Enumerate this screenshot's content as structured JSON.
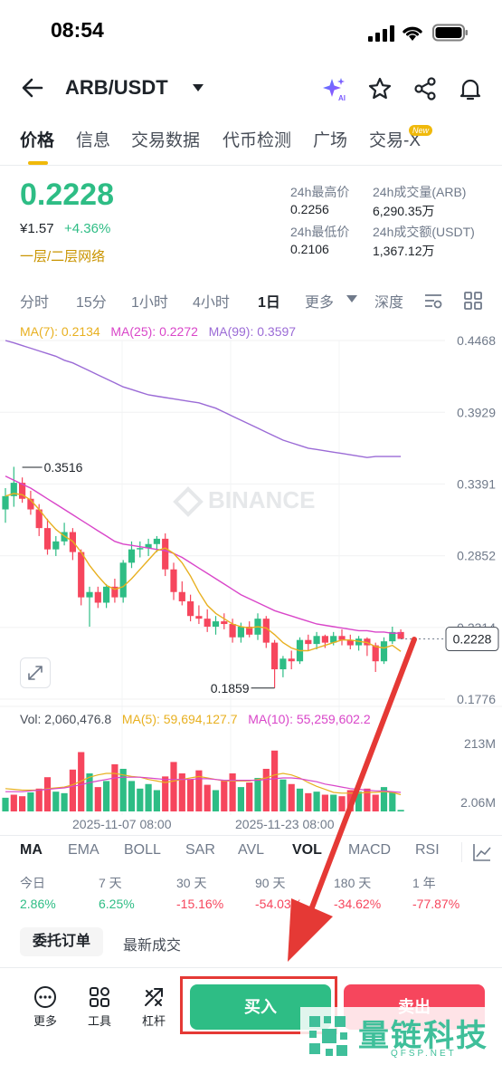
{
  "status_bar": {
    "time": "08:54"
  },
  "header": {
    "pair": "ARB/USDT"
  },
  "tabs": [
    "价格",
    "信息",
    "交易数据",
    "代币检测",
    "广场",
    "交易-X"
  ],
  "new_badge": "New",
  "ticker": {
    "price": "0.2228",
    "fiat": "¥1.57",
    "change": "+4.36%",
    "network": "一层/二层网络",
    "high_label": "24h最高价",
    "high_value": "0.2256",
    "low_label": "24h最低价",
    "low_value": "0.2106",
    "vol_label": "24h成交量(ARB)",
    "vol_value": "6,290.35万",
    "turnover_label": "24h成交额(USDT)",
    "turnover_value": "1,367.12万"
  },
  "intervals": [
    "分时",
    "15分",
    "1小时",
    "4小时",
    "1日",
    "更多",
    "深度"
  ],
  "ma": {
    "ma7": "MA(7): 0.2134",
    "ma25": "MA(25): 0.2272",
    "ma99": "MA(99): 0.3597"
  },
  "colors": {
    "up": "#2ebd85",
    "down": "#f6465d",
    "ma7": "#e8b020",
    "ma25": "#d946c9",
    "ma99": "#9b6bd6",
    "accent": "#f0b90b"
  },
  "chart_data": {
    "type": "candlestick",
    "y_ticks": [
      "0.4468",
      "0.3929",
      "0.3391",
      "0.2852",
      "0.2314",
      "0.1776"
    ],
    "ylim": [
      0.1776,
      0.4468
    ],
    "last_price": "0.2228",
    "high_marker": "0.3516",
    "low_marker": "0.1859",
    "watermark": "BINANCE",
    "candles": [
      [
        0.32,
        0.336,
        0.31,
        0.33
      ],
      [
        0.33,
        0.352,
        0.322,
        0.34
      ],
      [
        0.34,
        0.344,
        0.325,
        0.328
      ],
      [
        0.328,
        0.334,
        0.316,
        0.32
      ],
      [
        0.32,
        0.324,
        0.3,
        0.306
      ],
      [
        0.306,
        0.313,
        0.286,
        0.29
      ],
      [
        0.29,
        0.3,
        0.285,
        0.296
      ],
      [
        0.296,
        0.31,
        0.293,
        0.303
      ],
      [
        0.303,
        0.306,
        0.282,
        0.288
      ],
      [
        0.288,
        0.29,
        0.248,
        0.254
      ],
      [
        0.254,
        0.262,
        0.232,
        0.258
      ],
      [
        0.258,
        0.262,
        0.246,
        0.25
      ],
      [
        0.25,
        0.264,
        0.246,
        0.262
      ],
      [
        0.262,
        0.268,
        0.25,
        0.254
      ],
      [
        0.254,
        0.282,
        0.25,
        0.28
      ],
      [
        0.28,
        0.296,
        0.276,
        0.29
      ],
      [
        0.29,
        0.296,
        0.284,
        0.291
      ],
      [
        0.291,
        0.298,
        0.285,
        0.294
      ],
      [
        0.294,
        0.3,
        0.288,
        0.298
      ],
      [
        0.298,
        0.302,
        0.27,
        0.275
      ],
      [
        0.275,
        0.28,
        0.252,
        0.258
      ],
      [
        0.258,
        0.266,
        0.248,
        0.251
      ],
      [
        0.251,
        0.256,
        0.236,
        0.24
      ],
      [
        0.24,
        0.248,
        0.234,
        0.238
      ],
      [
        0.238,
        0.245,
        0.228,
        0.232
      ],
      [
        0.232,
        0.24,
        0.226,
        0.236
      ],
      [
        0.236,
        0.242,
        0.23,
        0.234
      ],
      [
        0.234,
        0.238,
        0.22,
        0.224
      ],
      [
        0.224,
        0.235,
        0.22,
        0.232
      ],
      [
        0.232,
        0.236,
        0.224,
        0.226
      ],
      [
        0.226,
        0.242,
        0.222,
        0.238
      ],
      [
        0.238,
        0.24,
        0.216,
        0.22
      ],
      [
        0.22,
        0.222,
        0.186,
        0.2
      ],
      [
        0.2,
        0.21,
        0.194,
        0.208
      ],
      [
        0.208,
        0.214,
        0.2,
        0.206
      ],
      [
        0.206,
        0.224,
        0.204,
        0.222
      ],
      [
        0.222,
        0.226,
        0.214,
        0.219
      ],
      [
        0.219,
        0.228,
        0.215,
        0.225
      ],
      [
        0.225,
        0.226,
        0.216,
        0.22
      ],
      [
        0.22,
        0.228,
        0.218,
        0.225
      ],
      [
        0.225,
        0.23,
        0.218,
        0.222
      ],
      [
        0.222,
        0.226,
        0.215,
        0.218
      ],
      [
        0.218,
        0.225,
        0.214,
        0.223
      ],
      [
        0.223,
        0.224,
        0.21,
        0.218
      ],
      [
        0.218,
        0.22,
        0.198,
        0.206
      ],
      [
        0.206,
        0.224,
        0.204,
        0.221
      ],
      [
        0.221,
        0.232,
        0.219,
        0.228
      ],
      [
        0.228,
        0.23,
        0.224,
        0.2228
      ]
    ],
    "ma99": [
      0.4468,
      0.445,
      0.443,
      0.441,
      0.439,
      0.437,
      0.435,
      0.432,
      0.43,
      0.427,
      0.424,
      0.421,
      0.418,
      0.415,
      0.412,
      0.41,
      0.408,
      0.406,
      0.405,
      0.404,
      0.403,
      0.402,
      0.401,
      0.4,
      0.398,
      0.396,
      0.393,
      0.39,
      0.387,
      0.384,
      0.381,
      0.378,
      0.375,
      0.372,
      0.37,
      0.368,
      0.366,
      0.365,
      0.364,
      0.363,
      0.362,
      0.361,
      0.36,
      0.359,
      0.3597,
      0.3597,
      0.3597,
      0.3597
    ],
    "ma25": [
      0.345,
      0.342,
      0.339,
      0.336,
      0.332,
      0.328,
      0.324,
      0.32,
      0.316,
      0.312,
      0.308,
      0.304,
      0.3,
      0.296,
      0.294,
      0.293,
      0.292,
      0.291,
      0.29,
      0.289,
      0.287,
      0.284,
      0.28,
      0.276,
      0.272,
      0.268,
      0.264,
      0.26,
      0.256,
      0.253,
      0.25,
      0.247,
      0.244,
      0.242,
      0.24,
      0.238,
      0.236,
      0.234,
      0.233,
      0.232,
      0.231,
      0.23,
      0.229,
      0.229,
      0.228,
      0.228,
      0.227,
      0.2272
    ],
    "ma7": [
      0.33,
      0.332,
      0.331,
      0.327,
      0.32,
      0.312,
      0.305,
      0.3,
      0.296,
      0.288,
      0.278,
      0.27,
      0.263,
      0.26,
      0.262,
      0.268,
      0.275,
      0.282,
      0.289,
      0.291,
      0.287,
      0.28,
      0.27,
      0.258,
      0.248,
      0.242,
      0.238,
      0.234,
      0.232,
      0.231,
      0.232,
      0.231,
      0.226,
      0.22,
      0.216,
      0.214,
      0.214,
      0.216,
      0.218,
      0.22,
      0.222,
      0.222,
      0.221,
      0.22,
      0.217,
      0.216,
      0.218,
      0.2134
    ]
  },
  "volume": {
    "label": "Vol: 2,060,476.8",
    "ma5": "MA(5): 59,694,127.7",
    "ma10": "MA(10): 55,259,602.2",
    "y_ticks": [
      "213M",
      "2.06M"
    ],
    "bars": [
      0.18,
      0.22,
      0.2,
      0.25,
      0.3,
      0.45,
      0.26,
      0.24,
      0.55,
      0.78,
      0.5,
      0.32,
      0.4,
      0.62,
      0.56,
      0.4,
      0.3,
      0.36,
      0.28,
      0.46,
      0.65,
      0.5,
      0.42,
      0.54,
      0.35,
      0.28,
      0.4,
      0.5,
      0.32,
      0.38,
      0.44,
      0.56,
      0.8,
      0.42,
      0.36,
      0.3,
      0.24,
      0.26,
      0.22,
      0.22,
      0.2,
      0.28,
      0.26,
      0.3,
      0.22,
      0.32,
      0.26,
      0.02
    ],
    "ma5_line": [
      0.3,
      0.29,
      0.28,
      0.28,
      0.28,
      0.3,
      0.31,
      0.32,
      0.35,
      0.4,
      0.45,
      0.48,
      0.5,
      0.5,
      0.48,
      0.46,
      0.45,
      0.42,
      0.4,
      0.38,
      0.4,
      0.42,
      0.44,
      0.46,
      0.44,
      0.42,
      0.4,
      0.4,
      0.4,
      0.4,
      0.42,
      0.44,
      0.48,
      0.5,
      0.48,
      0.44,
      0.38,
      0.33,
      0.29,
      0.25,
      0.24,
      0.24,
      0.24,
      0.25,
      0.25,
      0.26,
      0.25,
      0.22
    ],
    "ma10_line": [
      0.26,
      0.26,
      0.26,
      0.27,
      0.28,
      0.29,
      0.3,
      0.31,
      0.33,
      0.35,
      0.38,
      0.4,
      0.42,
      0.44,
      0.45,
      0.45,
      0.45,
      0.44,
      0.43,
      0.42,
      0.42,
      0.42,
      0.42,
      0.43,
      0.43,
      0.42,
      0.41,
      0.41,
      0.41,
      0.41,
      0.41,
      0.42,
      0.43,
      0.44,
      0.44,
      0.43,
      0.41,
      0.39,
      0.36,
      0.34,
      0.32,
      0.3,
      0.29,
      0.28,
      0.27,
      0.27,
      0.26,
      0.25
    ],
    "colors_up": [
      1,
      0,
      0,
      1,
      0,
      0,
      1,
      1,
      0,
      0,
      1,
      0,
      1,
      0,
      1,
      1,
      1,
      1,
      1,
      0,
      0,
      0,
      0,
      0,
      0,
      1,
      0,
      0,
      1,
      0,
      1,
      0,
      0,
      1,
      0,
      1,
      0,
      1,
      0,
      1,
      0,
      0,
      1,
      0,
      0,
      1,
      1,
      1
    ]
  },
  "dates": [
    "2025-11-07 08:00",
    "2025-11-23 08:00"
  ],
  "indicators": [
    "MA",
    "EMA",
    "BOLL",
    "SAR",
    "AVL",
    "VOL",
    "MACD",
    "RSI"
  ],
  "performance": [
    {
      "label": "今日",
      "value": "2.86%",
      "dir": "up"
    },
    {
      "label": "7 天",
      "value": "6.25%",
      "dir": "up"
    },
    {
      "label": "30 天",
      "value": "-15.16%",
      "dir": "down"
    },
    {
      "label": "90 天",
      "value": "-54.03%",
      "dir": "down"
    },
    {
      "label": "180 天",
      "value": "-34.62%",
      "dir": "down"
    },
    {
      "label": "1 年",
      "value": "-77.87%",
      "dir": "down"
    }
  ],
  "orders": {
    "tab1": "委托订单",
    "tab2": "最新成交"
  },
  "bottom": {
    "more": "更多",
    "tools": "工具",
    "leverage": "杠杆",
    "buy": "买入",
    "sell": "卖出"
  },
  "site_watermark": {
    "text": "量链科技",
    "url": "QFSP.NET"
  }
}
